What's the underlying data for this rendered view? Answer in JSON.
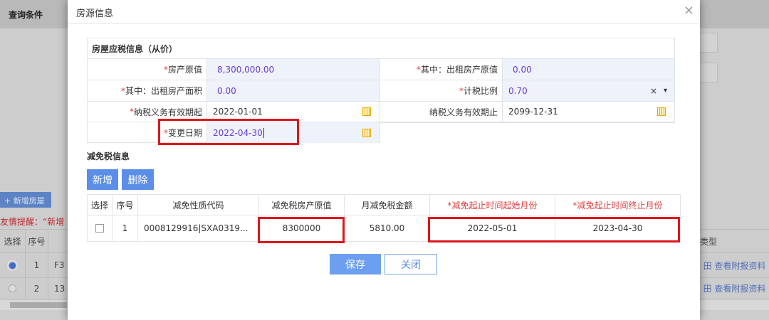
{
  "background": {
    "title": "查询条件",
    "add_button": "+ 新增房屋",
    "tip": "友情提醒：“新增",
    "columns": [
      "选择",
      "序号",
      "类型"
    ],
    "rows": [
      {
        "seq": "1",
        "code": "F3",
        "link": "田 查看附报资料",
        "selected": true
      },
      {
        "seq": "2",
        "code": "13",
        "link": "田 查看附报资料",
        "selected": false
      }
    ]
  },
  "modal": {
    "title": "房源信息",
    "close": "×",
    "section1": {
      "title": "房屋应税信息（从价）",
      "fields": [
        {
          "label": "房产原值",
          "required": true,
          "value": "8,300,000.00"
        },
        {
          "label": "其中：出租房产原值",
          "required": true,
          "value": "0.00"
        },
        {
          "label": "其中：出租房产面积",
          "required": true,
          "value": "0.00"
        },
        {
          "label": "计税比例",
          "required": true,
          "value": "0.70",
          "clear": "×",
          "arrow": "▾"
        },
        {
          "label": "纳税义务有效期起",
          "required": true,
          "value": "2022-01-01"
        },
        {
          "label": "纳税义务有效期止",
          "required": false,
          "value": "2099-12-31"
        },
        {
          "label": "变更日期",
          "required": true,
          "value": "2022-04-30"
        }
      ]
    },
    "section2": {
      "title": "减免税信息",
      "add": "新增",
      "delete": "删除",
      "columns": [
        "选择",
        "序号",
        "减免性质代码",
        "减免税房产原值",
        "月减免税金额",
        "*减免起止时间起始月份",
        "*减免起止时间终止月份"
      ],
      "rows": [
        {
          "seq": "1",
          "code": "0008129916|SXA0319...",
          "value": "8300000",
          "monthly": "5810.00",
          "start": "2022-05-01",
          "end": "2023-04-30"
        }
      ]
    },
    "save": "保存",
    "close_btn": "关闭"
  }
}
